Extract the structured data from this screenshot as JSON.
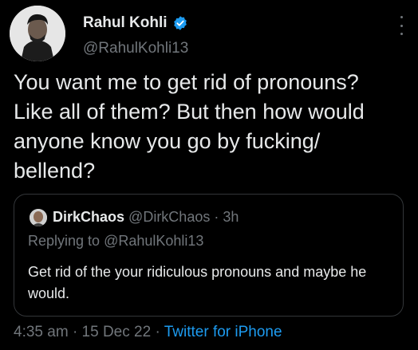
{
  "author": {
    "name": "Rahul Kohli",
    "handle": "@RahulKohli13",
    "verified": true
  },
  "tweet": {
    "text": "You want me to get rid of pronouns?\nLike all of them? But then how would\nanyone know you go by fucking/\nbellend?"
  },
  "quoted": {
    "name": "DirkChaos",
    "handle": "@DirkChaos",
    "separator": "·",
    "time": "3h",
    "reply_prefix": "Replying to ",
    "reply_to": "@RahulKohli13",
    "text": "Get rid of the your ridiculous pronouns and maybe he would."
  },
  "meta": {
    "time": "4:35 am",
    "sep1": "·",
    "date": "15 Dec 22",
    "sep2": "·",
    "source": "Twitter for iPhone"
  },
  "colors": {
    "background": "#000000",
    "text": "#e7e9ea",
    "secondary": "#71767b",
    "accent": "#1d9bf0"
  }
}
